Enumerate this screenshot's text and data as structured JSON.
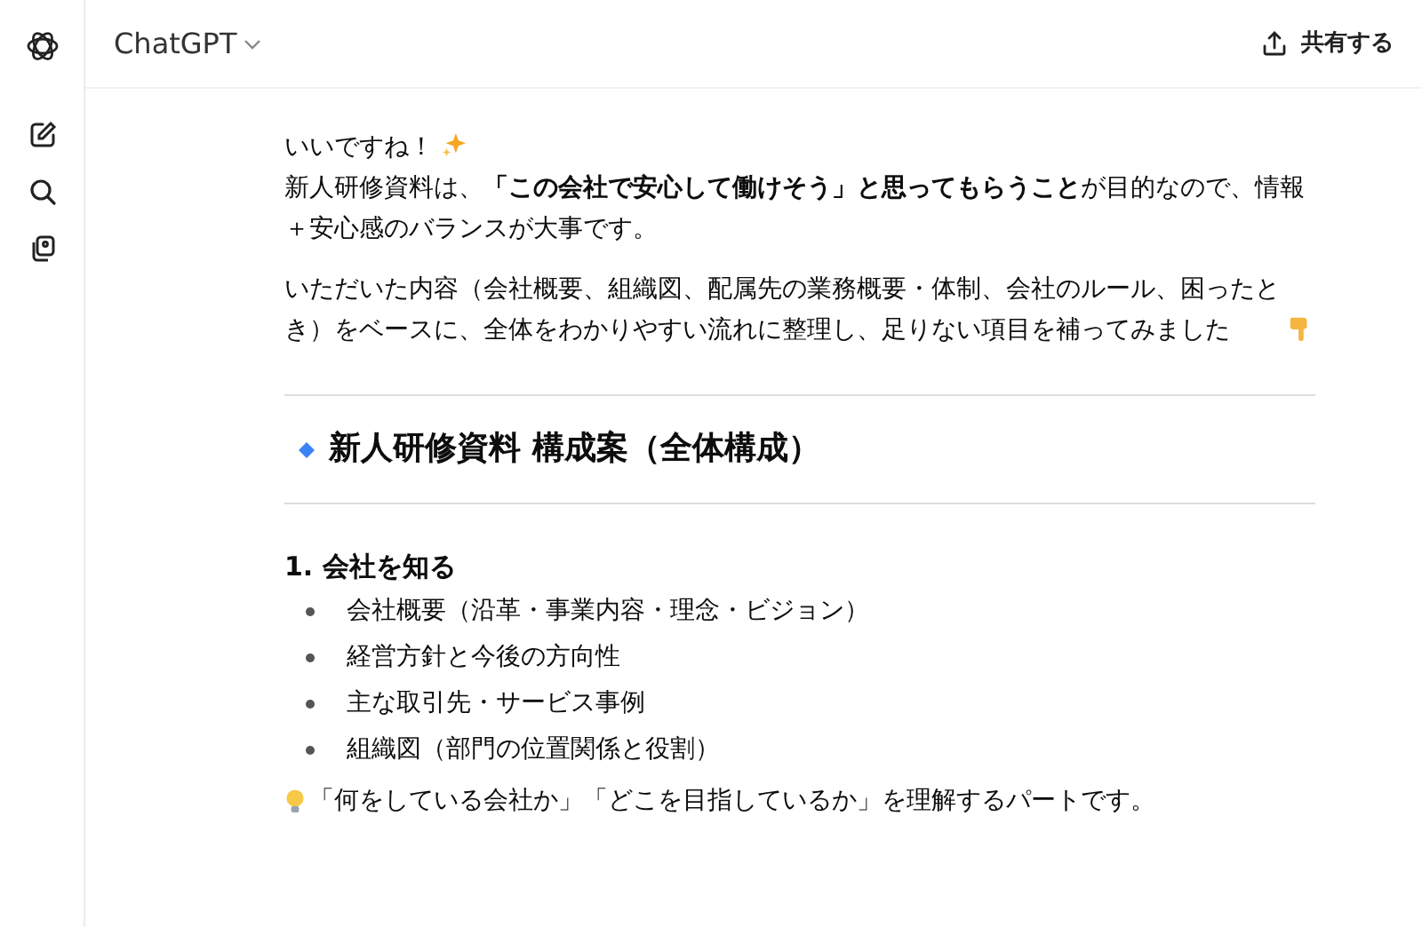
{
  "header": {
    "model": "ChatGPT",
    "share": "共有する"
  },
  "message": {
    "greeting": "いいですね！",
    "intro": "新人研修資料は、**「この会社で安心して働けそう」と思ってもらうこと**が目的なので、情報＋安心感のバランスが大事です。",
    "context": "いただいた内容（会社概要、組織図、配属先の業務概要・体制、会社のルール、困ったとき）をベースに、全体をわかりやすい流れに整理し、足りない項目を補ってみました",
    "heading": "新人研修資料 構成案（全体構成）",
    "sections": [
      {
        "title": "1. 会社を知る",
        "items": [
          "会社概要（沿革・事業内容・理念・ビジョン）",
          "経営方針と今後の方向性",
          "主な取引先・サービス事例",
          "組織図（部門の位置関係と役割）"
        ],
        "tip": "「何をしている会社か」「どこを目指しているか」を理解するパートです。"
      }
    ]
  }
}
